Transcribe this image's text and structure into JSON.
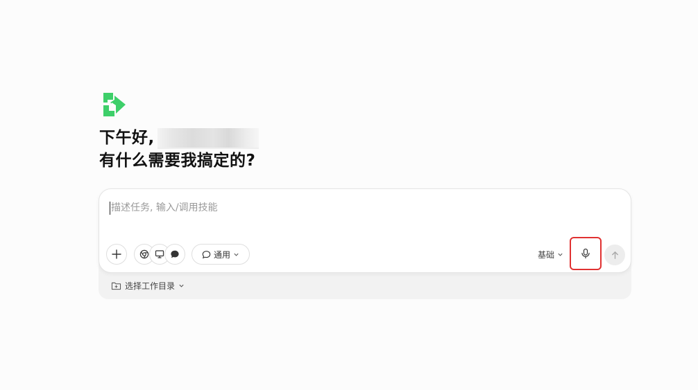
{
  "greeting": {
    "line1_prefix": "下午好,",
    "line2": "有什么需要我搞定的?"
  },
  "composer": {
    "placeholder": "描述任务, 输入/调用技能",
    "value": "",
    "toolbar": {
      "add_icon": "plus-icon",
      "tool_icons": [
        "chrome-icon",
        "monitor-icon",
        "chat-bubble-icon"
      ],
      "mode_label": "通用",
      "mode_icon": "chat-outline-icon",
      "level_label": "基础",
      "mic_icon": "microphone-icon",
      "send_icon": "arrow-up-icon"
    }
  },
  "workdir": {
    "label": "选择工作目录",
    "icon": "folder-plus-icon"
  },
  "colors": {
    "brand": "#3ecf6a",
    "highlight": "#e03131"
  }
}
